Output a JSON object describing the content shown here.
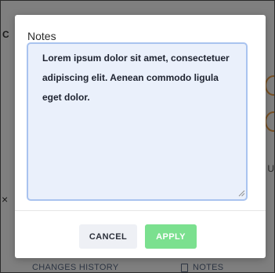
{
  "background": {
    "edge_text": "C",
    "close_glyph": "×",
    "right_text": "U",
    "tabs": {
      "history": "CHANGES HISTORY",
      "notes": "NOTES"
    },
    "icons": [
      "document-icon"
    ],
    "colors": {
      "accent_orange": "#f0a24a",
      "muted": "#5a6b86"
    }
  },
  "modal": {
    "label": "Notes",
    "notes_value": "Lorem ipsum dolor sit amet, consectetuer adipiscing elit. Aenean commodo ligula eget dolor.",
    "buttons": {
      "cancel": "CANCEL",
      "apply": "APPLY"
    },
    "colors": {
      "textarea_bg": "#eaf0fb",
      "textarea_border": "#a9c3ef",
      "apply_bg": "#7be08f",
      "cancel_bg": "#eef0f5"
    }
  }
}
